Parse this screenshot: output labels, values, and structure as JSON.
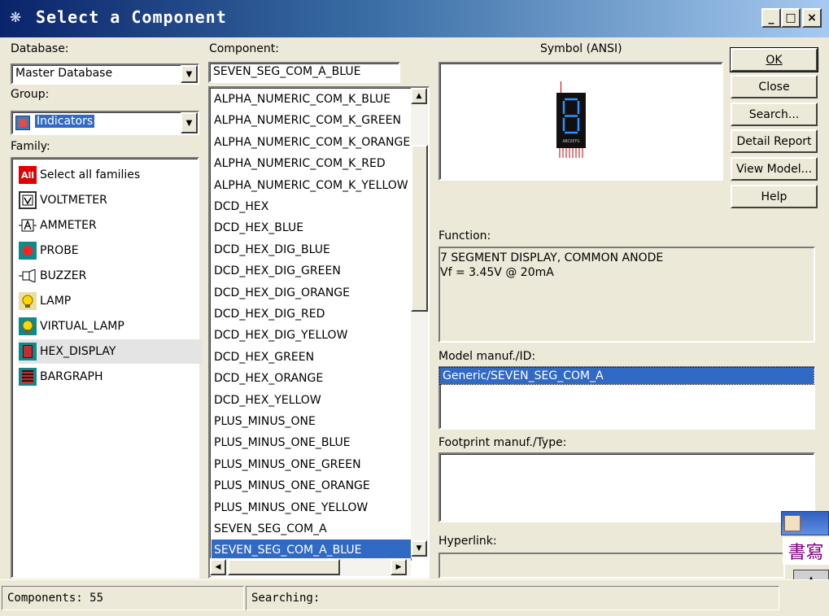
{
  "window": {
    "title": "Select a Component",
    "minimize_label": "_",
    "maximize_label": "□",
    "close_label": "×"
  },
  "database": {
    "label": "Database:",
    "value": "Master Database"
  },
  "group": {
    "label": "Group:",
    "value": "Indicators"
  },
  "family": {
    "label": "Family:",
    "items": [
      {
        "label": "Select all families",
        "icon": "all-families-icon"
      },
      {
        "label": "VOLTMETER",
        "icon": "voltmeter-icon"
      },
      {
        "label": "AMMETER",
        "icon": "ammeter-icon"
      },
      {
        "label": "PROBE",
        "icon": "probe-icon"
      },
      {
        "label": "BUZZER",
        "icon": "buzzer-icon"
      },
      {
        "label": "LAMP",
        "icon": "lamp-icon"
      },
      {
        "label": "VIRTUAL_LAMP",
        "icon": "virtual-lamp-icon"
      },
      {
        "label": "HEX_DISPLAY",
        "icon": "hex-display-icon"
      },
      {
        "label": "BARGRAPH",
        "icon": "bargraph-icon"
      }
    ],
    "all_badge": "All"
  },
  "component": {
    "label": "Component:",
    "value": "SEVEN_SEG_COM_A_BLUE",
    "items": [
      "ALPHA_NUMERIC_COM_K_BLUE",
      "ALPHA_NUMERIC_COM_K_GREEN",
      "ALPHA_NUMERIC_COM_K_ORANGE",
      "ALPHA_NUMERIC_COM_K_RED",
      "ALPHA_NUMERIC_COM_K_YELLOW",
      "DCD_HEX",
      "DCD_HEX_BLUE",
      "DCD_HEX_DIG_BLUE",
      "DCD_HEX_DIG_GREEN",
      "DCD_HEX_DIG_ORANGE",
      "DCD_HEX_DIG_RED",
      "DCD_HEX_DIG_YELLOW",
      "DCD_HEX_GREEN",
      "DCD_HEX_ORANGE",
      "DCD_HEX_YELLOW",
      "PLUS_MINUS_ONE",
      "PLUS_MINUS_ONE_BLUE",
      "PLUS_MINUS_ONE_GREEN",
      "PLUS_MINUS_ONE_ORANGE",
      "PLUS_MINUS_ONE_YELLOW",
      "SEVEN_SEG_COM_A",
      "SEVEN_SEG_COM_A_BLUE"
    ]
  },
  "symbol": {
    "label": "Symbol (ANSI)",
    "digit": "8",
    "pins_label": "ABCDEFG"
  },
  "buttons": {
    "ok": "OK",
    "close": "Close",
    "search": "Search...",
    "detail_report": "Detail Report",
    "view_model": "View Model...",
    "help": "Help"
  },
  "function": {
    "label": "Function:",
    "line1": "7 SEGMENT DISPLAY, COMMON ANODE",
    "line2": "Vf = 3.45V @ 20mA"
  },
  "model": {
    "label": "Model manuf./ID:",
    "value": "Generic/SEVEN_SEG_COM_A"
  },
  "footprint": {
    "label": "Footprint manuf./Type:"
  },
  "hyperlink": {
    "label": "Hyperlink:"
  },
  "status": {
    "components": "Components: 55",
    "searching": "Searching:"
  },
  "ime": {
    "text": "書寫"
  },
  "colors": {
    "selection": "#316ac5",
    "title_start": "#0a246a",
    "title_end": "#a6caf0"
  }
}
